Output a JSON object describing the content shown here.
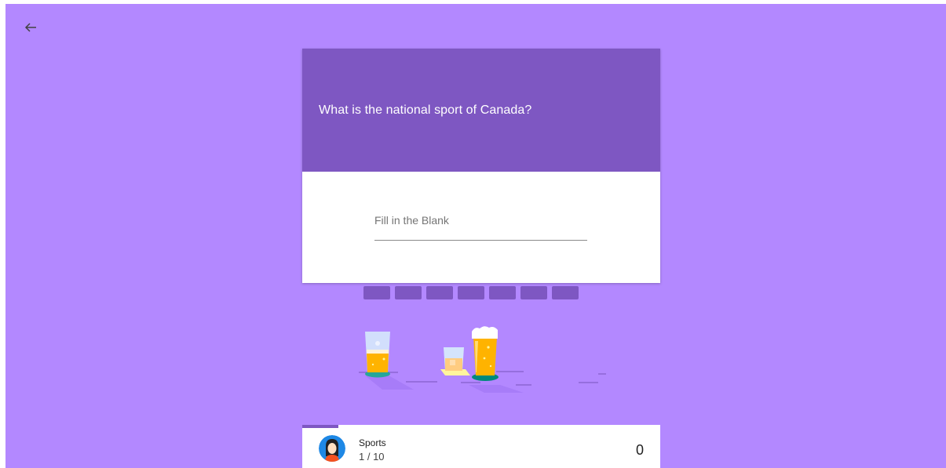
{
  "nav": {
    "back_icon": "arrow-left-icon"
  },
  "question": {
    "text": "What is the national sport of Canada?"
  },
  "answer": {
    "placeholder": "Fill in the Blank",
    "value": ""
  },
  "blanks": {
    "count": 7
  },
  "footer": {
    "category": "Sports",
    "progress_text": "1 / 10",
    "progress_fraction": 0.1,
    "score": "0",
    "avatar_icon": "player-avatar-icon"
  },
  "colors": {
    "background": "#b388ff",
    "accent": "#7e57c2",
    "card": "#ffffff"
  }
}
